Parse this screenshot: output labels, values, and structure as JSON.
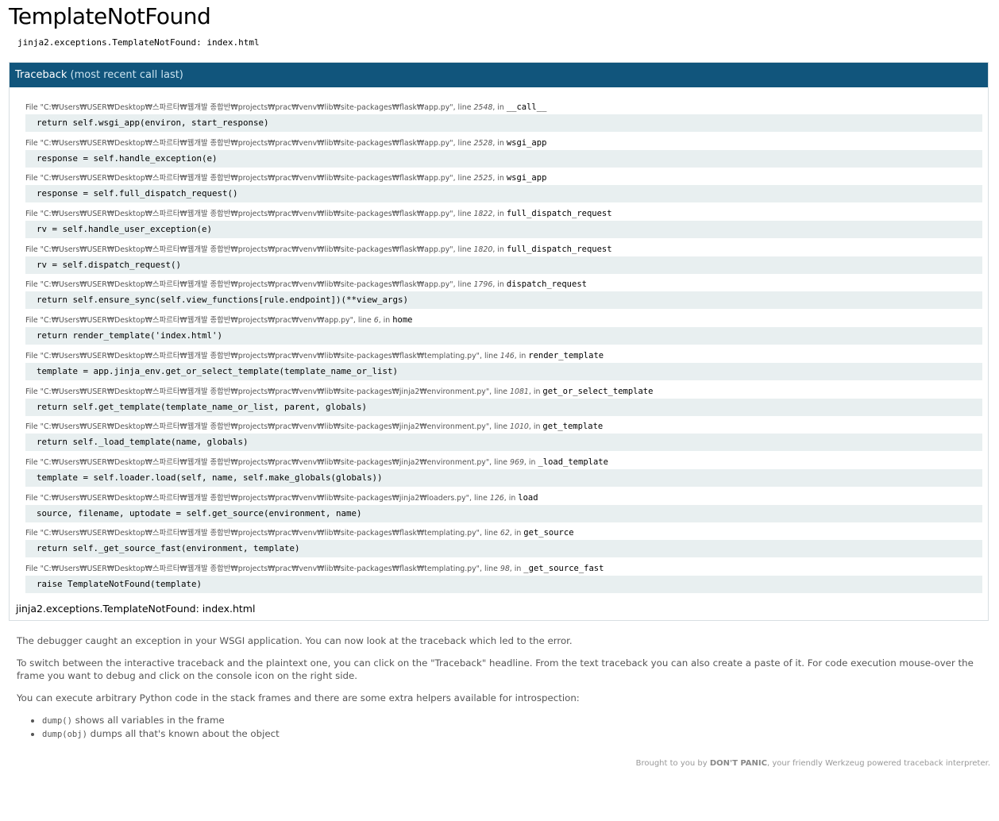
{
  "title": "TemplateNotFound",
  "errormsg": "jinja2.exceptions.TemplateNotFound: index.html",
  "traceback": {
    "header_strong": "Traceback",
    "header_muted": "(most recent call last)",
    "file_prefix": "File ",
    "line_word": ", line ",
    "in_word": ", in ",
    "frames": [
      {
        "file": "\"C:₩Users₩USER₩Desktop₩스파르타₩웹개발 종합반₩projects₩prac₩venv₩lib₩site-packages₩flask₩app.py\"",
        "line": "2548",
        "func": "__call__",
        "code": "return self.wsgi_app(environ, start_response)"
      },
      {
        "file": "\"C:₩Users₩USER₩Desktop₩스파르타₩웹개발 종합반₩projects₩prac₩venv₩lib₩site-packages₩flask₩app.py\"",
        "line": "2528",
        "func": "wsgi_app",
        "code": "response = self.handle_exception(e)"
      },
      {
        "file": "\"C:₩Users₩USER₩Desktop₩스파르타₩웹개발 종합반₩projects₩prac₩venv₩lib₩site-packages₩flask₩app.py\"",
        "line": "2525",
        "func": "wsgi_app",
        "code": "response = self.full_dispatch_request()"
      },
      {
        "file": "\"C:₩Users₩USER₩Desktop₩스파르타₩웹개발 종합반₩projects₩prac₩venv₩lib₩site-packages₩flask₩app.py\"",
        "line": "1822",
        "func": "full_dispatch_request",
        "code": "rv = self.handle_user_exception(e)"
      },
      {
        "file": "\"C:₩Users₩USER₩Desktop₩스파르타₩웹개발 종합반₩projects₩prac₩venv₩lib₩site-packages₩flask₩app.py\"",
        "line": "1820",
        "func": "full_dispatch_request",
        "code": "rv = self.dispatch_request()"
      },
      {
        "file": "\"C:₩Users₩USER₩Desktop₩스파르타₩웹개발 종합반₩projects₩prac₩venv₩lib₩site-packages₩flask₩app.py\"",
        "line": "1796",
        "func": "dispatch_request",
        "code": "return self.ensure_sync(self.view_functions[rule.endpoint])(**view_args)"
      },
      {
        "file": "\"C:₩Users₩USER₩Desktop₩스파르타₩웹개발 종합반₩projects₩prac₩venv₩app.py\"",
        "line": "6",
        "func": "home",
        "code": "return render_template('index.html')"
      },
      {
        "file": "\"C:₩Users₩USER₩Desktop₩스파르타₩웹개발 종합반₩projects₩prac₩venv₩lib₩site-packages₩flask₩templating.py\"",
        "line": "146",
        "func": "render_template",
        "code": "template = app.jinja_env.get_or_select_template(template_name_or_list)"
      },
      {
        "file": "\"C:₩Users₩USER₩Desktop₩스파르타₩웹개발 종합반₩projects₩prac₩venv₩lib₩site-packages₩jinja2₩environment.py\"",
        "line": "1081",
        "func": "get_or_select_template",
        "code": "return self.get_template(template_name_or_list, parent, globals)"
      },
      {
        "file": "\"C:₩Users₩USER₩Desktop₩스파르타₩웹개발 종합반₩projects₩prac₩venv₩lib₩site-packages₩jinja2₩environment.py\"",
        "line": "1010",
        "func": "get_template",
        "code": "return self._load_template(name, globals)"
      },
      {
        "file": "\"C:₩Users₩USER₩Desktop₩스파르타₩웹개발 종합반₩projects₩prac₩venv₩lib₩site-packages₩jinja2₩environment.py\"",
        "line": "969",
        "func": "_load_template",
        "code": "template = self.loader.load(self, name, self.make_globals(globals))"
      },
      {
        "file": "\"C:₩Users₩USER₩Desktop₩스파르타₩웹개발 종합반₩projects₩prac₩venv₩lib₩site-packages₩jinja2₩loaders.py\"",
        "line": "126",
        "func": "load",
        "code": "source, filename, uptodate = self.get_source(environment, name)"
      },
      {
        "file": "\"C:₩Users₩USER₩Desktop₩스파르타₩웹개발 종합반₩projects₩prac₩venv₩lib₩site-packages₩flask₩templating.py\"",
        "line": "62",
        "func": "get_source",
        "code": "return self._get_source_fast(environment, template)"
      },
      {
        "file": "\"C:₩Users₩USER₩Desktop₩스파르타₩웹개발 종합반₩projects₩prac₩venv₩lib₩site-packages₩flask₩templating.py\"",
        "line": "98",
        "func": "_get_source_fast",
        "code": "raise TemplateNotFound(template)"
      }
    ],
    "footer": "jinja2.exceptions.TemplateNotFound: index.html"
  },
  "explanation": {
    "p1": "The debugger caught an exception in your WSGI application. You can now look at the traceback which led to the error.",
    "p2": "To switch between the interactive traceback and the plaintext one, you can click on the \"Traceback\" headline. From the text traceback you can also create a paste of it. For code execution mouse-over the frame you want to debug and click on the console icon on the right side.",
    "p3": "You can execute arbitrary Python code in the stack frames and there are some extra helpers available for introspection:",
    "helpers": [
      {
        "code": "dump()",
        "text": " shows all variables in the frame"
      },
      {
        "code": "dump(obj)",
        "text": " dumps all that's known about the object"
      }
    ]
  },
  "footer": {
    "prefix": "Brought to you by ",
    "strong": "DON'T PANIC",
    "middle": ", your friendly Werkzeug powered traceback interpreter."
  }
}
